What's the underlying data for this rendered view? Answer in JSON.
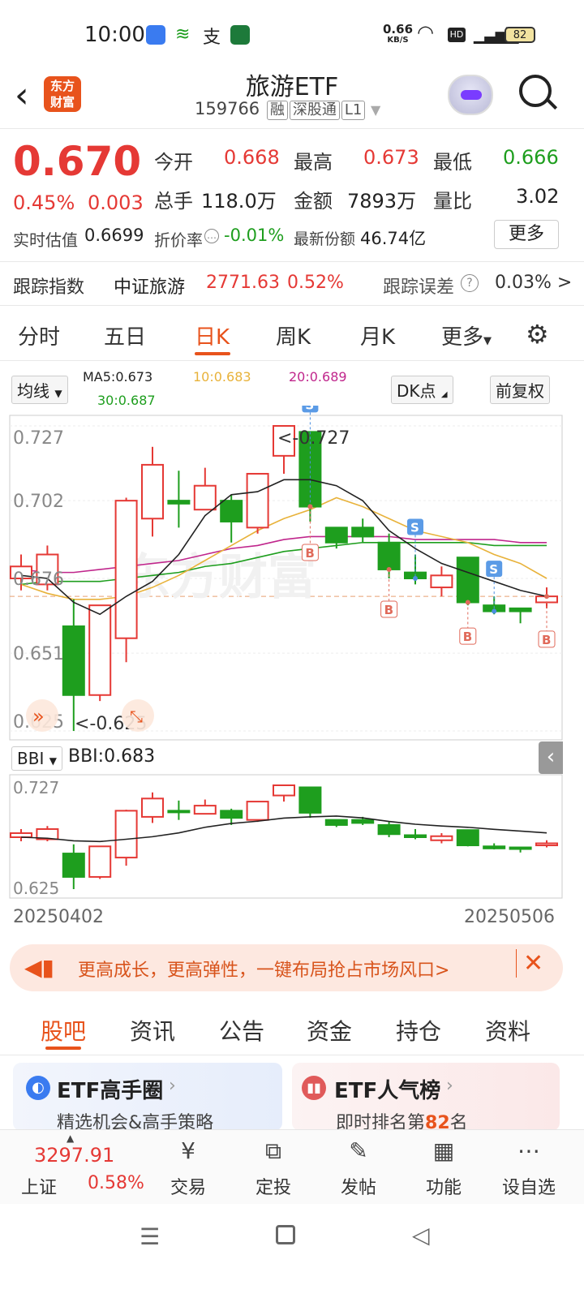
{
  "status_bar": {
    "time": "10:00",
    "net_speed_value": "0.66",
    "net_speed_unit": "KB/S",
    "battery": "82",
    "icons": [
      "wechat-icon",
      "post-icon",
      "alipay-icon",
      "bank-icon",
      "wifi-icon",
      "hd-icon",
      "signal-icon",
      "battery-icon"
    ]
  },
  "header": {
    "back_icon": "chevron-left-icon",
    "logo_text": "东方财富",
    "title": "旅游ETF",
    "code": "159766",
    "tags": [
      "融",
      "深股通",
      "L1"
    ],
    "search_icon": "search-icon",
    "robot_icon": "robot-avatar-icon"
  },
  "quote": {
    "price": "0.670",
    "change_pct": "0.45%",
    "change_abs": "0.003",
    "stats": [
      {
        "label": "今开",
        "value": "0.668",
        "color": "red"
      },
      {
        "label": "最高",
        "value": "0.673",
        "color": "red"
      },
      {
        "label": "最低",
        "value": "0.666",
        "color": "green"
      },
      {
        "label": "总手",
        "value": "118.0万",
        "color": "black"
      },
      {
        "label": "金额",
        "value": "7893万",
        "color": "black"
      },
      {
        "label": "量比",
        "value": "3.02",
        "color": "black"
      }
    ],
    "realtime_label": "实时估值",
    "realtime_value": "0.6699",
    "discount_label": "折价率",
    "discount_value": "-0.01%",
    "shares_label": "最新份额",
    "shares_value": "46.74亿",
    "more_button": "更多",
    "track_label": "跟踪指数",
    "track_index": "中证旅游",
    "track_value": "2771.63",
    "track_pct": "0.52%",
    "error_label": "跟踪误差",
    "error_value": "0.03% >"
  },
  "chart_tabs": {
    "items": [
      "分时",
      "五日",
      "日K",
      "周K",
      "月K",
      "更多"
    ],
    "active": "日K",
    "settings_icon": "gear-icon"
  },
  "indicators": {
    "ma_select": "均线",
    "ma5": "MA5:0.673",
    "ma10": "10:0.683",
    "ma20": "20:0.689",
    "ma30": "30:0.687",
    "dk_button": "DK点",
    "adjust_button": "前复权",
    "bbi_select": "BBI",
    "bbi_value": "BBI:0.683"
  },
  "chart_data": {
    "type": "candlestick",
    "y_labels_main": [
      "0.727",
      "0.702",
      "0.676",
      "0.651",
      "0.625"
    ],
    "ylim_main": [
      0.625,
      0.727
    ],
    "y_labels_sub": [
      "0.727",
      "0.625"
    ],
    "x_labels": [
      "20250402",
      "20250506"
    ],
    "watermark": "东方财富",
    "annotations": {
      "high": "<-0.727",
      "low": "<-0.625"
    },
    "signals": [
      {
        "index": 11,
        "type": "S"
      },
      {
        "index": 15,
        "type": "S"
      },
      {
        "index": 18,
        "type": "S"
      },
      {
        "index": 11,
        "type": "B"
      },
      {
        "index": 14,
        "type": "B"
      },
      {
        "index": 17,
        "type": "B"
      },
      {
        "index": 20,
        "type": "B"
      }
    ],
    "candles": [
      {
        "o": 0.676,
        "c": 0.68,
        "h": 0.684,
        "l": 0.672
      },
      {
        "o": 0.674,
        "c": 0.684,
        "h": 0.687,
        "l": 0.672
      },
      {
        "o": 0.66,
        "c": 0.637,
        "h": 0.669,
        "l": 0.625
      },
      {
        "o": 0.637,
        "c": 0.667,
        "h": 0.667,
        "l": 0.635
      },
      {
        "o": 0.656,
        "c": 0.702,
        "h": 0.703,
        "l": 0.648
      },
      {
        "o": 0.696,
        "c": 0.714,
        "h": 0.72,
        "l": 0.69
      },
      {
        "o": 0.702,
        "c": 0.701,
        "h": 0.712,
        "l": 0.693
      },
      {
        "o": 0.699,
        "c": 0.707,
        "h": 0.713,
        "l": 0.699
      },
      {
        "o": 0.702,
        "c": 0.695,
        "h": 0.704,
        "l": 0.688
      },
      {
        "o": 0.693,
        "c": 0.711,
        "h": 0.711,
        "l": 0.691
      },
      {
        "o": 0.717,
        "c": 0.727,
        "h": 0.727,
        "l": 0.711
      },
      {
        "o": 0.725,
        "c": 0.7,
        "h": 0.725,
        "l": 0.695
      },
      {
        "o": 0.693,
        "c": 0.688,
        "h": 0.693,
        "l": 0.686
      },
      {
        "o": 0.693,
        "c": 0.69,
        "h": 0.696,
        "l": 0.688
      },
      {
        "o": 0.688,
        "c": 0.679,
        "h": 0.691,
        "l": 0.676
      },
      {
        "o": 0.678,
        "c": 0.676,
        "h": 0.684,
        "l": 0.674
      },
      {
        "o": 0.673,
        "c": 0.677,
        "h": 0.68,
        "l": 0.67
      },
      {
        "o": 0.683,
        "c": 0.668,
        "h": 0.683,
        "l": 0.667
      },
      {
        "o": 0.667,
        "c": 0.665,
        "h": 0.67,
        "l": 0.664
      },
      {
        "o": 0.666,
        "c": 0.665,
        "h": 0.666,
        "l": 0.661
      },
      {
        "o": 0.668,
        "c": 0.67,
        "h": 0.673,
        "l": 0.666
      }
    ],
    "ma5_series": [
      0.677,
      0.676,
      0.668,
      0.664,
      0.67,
      0.675,
      0.684,
      0.697,
      0.704,
      0.705,
      0.709,
      0.709,
      0.707,
      0.702,
      0.692,
      0.686,
      0.681,
      0.678,
      0.675,
      0.672,
      0.67
    ],
    "ma10_series": [
      0.674,
      0.671,
      0.669,
      0.669,
      0.67,
      0.673,
      0.677,
      0.682,
      0.687,
      0.692,
      0.696,
      0.699,
      0.703,
      0.7,
      0.696,
      0.692,
      0.69,
      0.688,
      0.684,
      0.681,
      0.676
    ],
    "ma20_series": [
      0.679,
      0.678,
      0.678,
      0.679,
      0.68,
      0.681,
      0.682,
      0.684,
      0.686,
      0.687,
      0.689,
      0.69,
      0.69,
      0.69,
      0.69,
      0.689,
      0.689,
      0.689,
      0.689,
      0.688,
      0.688
    ],
    "ma30_series": [
      0.674,
      0.675,
      0.675,
      0.675,
      0.676,
      0.677,
      0.678,
      0.68,
      0.681,
      0.683,
      0.685,
      0.686,
      0.687,
      0.688,
      0.688,
      0.688,
      0.688,
      0.688,
      0.687,
      0.687,
      0.687
    ]
  },
  "banner": {
    "text": "更高成长，更高弹性，一键布局抢占市场风口>",
    "megaphone_icon": "megaphone-icon",
    "close_icon": "close-icon"
  },
  "bottom_tabs": {
    "items": [
      "股吧",
      "资讯",
      "公告",
      "资金",
      "持仓",
      "资料"
    ],
    "active": "股吧"
  },
  "cards": [
    {
      "title": "ETF高手圈",
      "subtitle": "精选机会&高手策略"
    },
    {
      "title": "ETF人气榜",
      "subtitle_prefix": "即时排名第",
      "rank": "82",
      "subtitle_suffix": "名"
    }
  ],
  "nav": {
    "index_value": "3297.91",
    "index_name": "上证",
    "index_pct": "0.58%",
    "items": [
      {
        "label": "交易",
        "icon": "yuan-icon"
      },
      {
        "label": "定投",
        "icon": "chart-calendar-icon"
      },
      {
        "label": "发帖",
        "icon": "edit-icon"
      },
      {
        "label": "功能",
        "icon": "grid-icon"
      },
      {
        "label": "设自选",
        "icon": "more-dots-icon"
      }
    ]
  },
  "colors": {
    "up": "#e53935",
    "down": "#1e9e1e",
    "accent": "#e8531c",
    "ma5": "#222222",
    "ma10": "#e8b23a",
    "ma20": "#c0268c",
    "ma30": "#1e9e1e"
  }
}
